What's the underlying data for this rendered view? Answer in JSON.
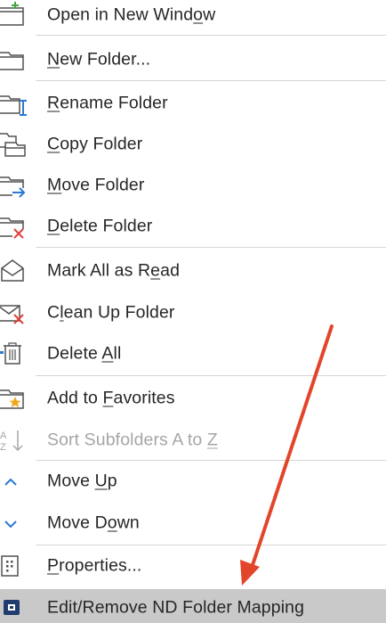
{
  "menu": {
    "items": [
      {
        "icon": "open-new-window-icon",
        "label": "Open in New Window",
        "disabled": false
      },
      {
        "icon": "new-folder-icon",
        "label": "New Folder...",
        "disabled": false
      },
      {
        "icon": "rename-folder-icon",
        "label": "Rename Folder",
        "disabled": false
      },
      {
        "icon": "copy-folder-icon",
        "label": "Copy Folder",
        "disabled": false
      },
      {
        "icon": "move-folder-icon",
        "label": "Move Folder",
        "disabled": false
      },
      {
        "icon": "delete-folder-icon",
        "label": "Delete Folder",
        "disabled": false
      },
      {
        "icon": "mark-all-read-icon",
        "label": "Mark All as Read",
        "disabled": false
      },
      {
        "icon": "clean-up-folder-icon",
        "label": "Clean Up Folder",
        "disabled": false
      },
      {
        "icon": "delete-all-icon",
        "label": "Delete All",
        "disabled": false
      },
      {
        "icon": "add-to-favorites-icon",
        "label": "Add to Favorites",
        "disabled": false
      },
      {
        "icon": "sort-subfolders-icon",
        "label": "Sort Subfolders A to Z",
        "disabled": true
      },
      {
        "icon": "move-up-icon",
        "label": "Move Up",
        "disabled": false
      },
      {
        "icon": "move-down-icon",
        "label": "Move Down",
        "disabled": false
      },
      {
        "icon": "properties-icon",
        "label": "Properties...",
        "disabled": false
      },
      {
        "icon": "nd-folder-mapping-icon",
        "label": "Edit/Remove ND Folder Mapping",
        "disabled": false,
        "highlighted": true
      }
    ]
  },
  "annotation": {
    "arrow_color": "#e3452b"
  },
  "colors": {
    "highlight": "#c9c9c9",
    "separator": "#d5d5d5",
    "icon_blue": "#2b79d3",
    "icon_red": "#e0403a",
    "icon_green": "#3ea83e",
    "icon_star": "#f2a81d"
  }
}
